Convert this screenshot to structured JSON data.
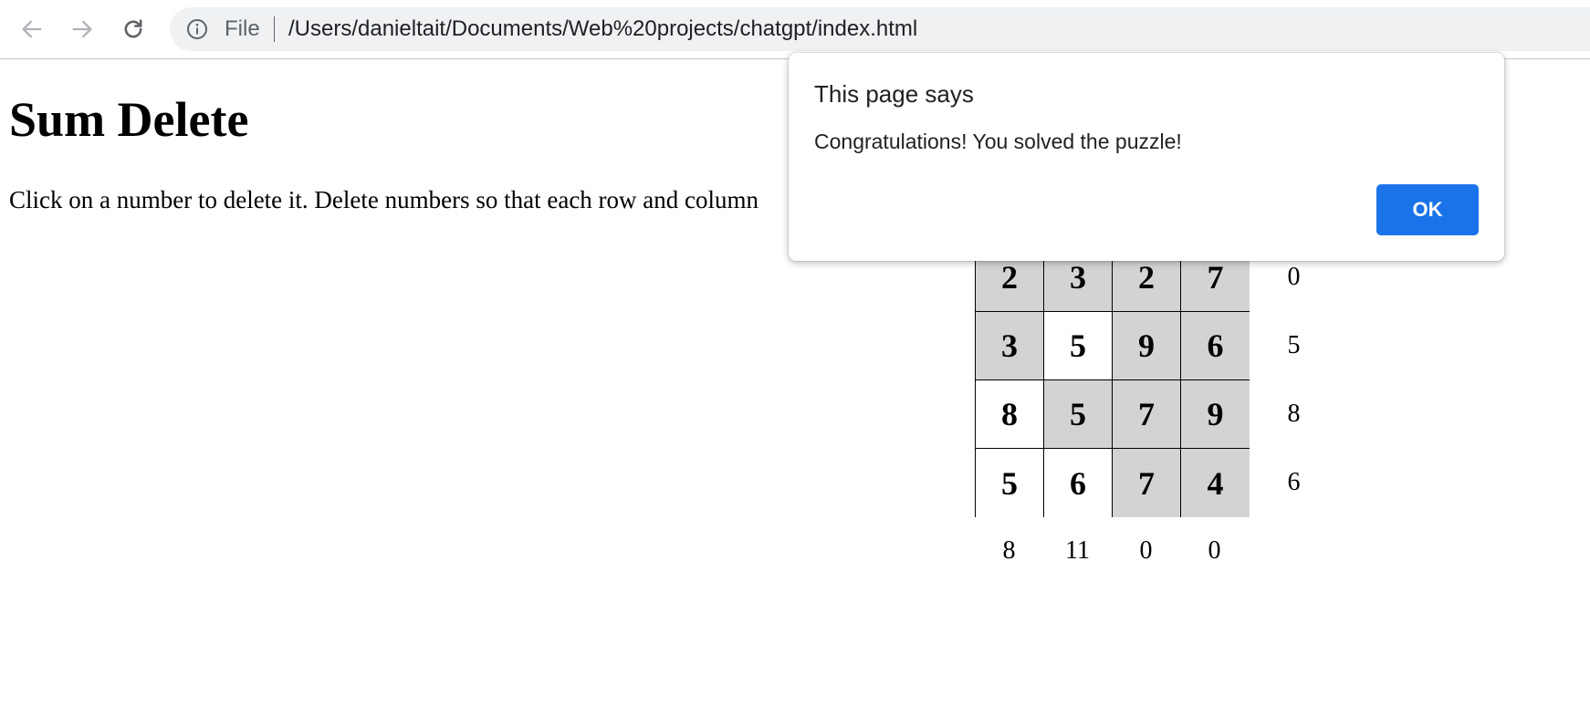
{
  "browser": {
    "back_icon": "arrow-left-icon",
    "forward_icon": "arrow-right-icon",
    "reload_icon": "reload-icon",
    "info_icon": "info-icon",
    "url_scheme_label": "File",
    "url": "/Users/danieltait/Documents/Web%20projects/chatgpt/index.html"
  },
  "page": {
    "title": "Sum Delete",
    "instructions": "Click on a number to delete it. Delete numbers so that each row and column"
  },
  "puzzle": {
    "rows": [
      [
        {
          "value": "2",
          "deleted": true
        },
        {
          "value": "3",
          "deleted": true
        },
        {
          "value": "2",
          "deleted": true
        },
        {
          "value": "7",
          "deleted": true
        }
      ],
      [
        {
          "value": "3",
          "deleted": true
        },
        {
          "value": "5",
          "deleted": false
        },
        {
          "value": "9",
          "deleted": true
        },
        {
          "value": "6",
          "deleted": true
        }
      ],
      [
        {
          "value": "8",
          "deleted": false
        },
        {
          "value": "5",
          "deleted": true
        },
        {
          "value": "7",
          "deleted": true
        },
        {
          "value": "9",
          "deleted": true
        }
      ],
      [
        {
          "value": "5",
          "deleted": false
        },
        {
          "value": "6",
          "deleted": false
        },
        {
          "value": "7",
          "deleted": true
        },
        {
          "value": "4",
          "deleted": true
        }
      ]
    ],
    "row_sums": [
      "0",
      "5",
      "8",
      "6"
    ],
    "col_sums": [
      "8",
      "11",
      "0",
      "0"
    ],
    "colors": {
      "deleted": "#d3d3d3",
      "kept": "#ffffff"
    }
  },
  "dialog": {
    "title": "This page says",
    "message": "Congratulations! You solved the puzzle!",
    "ok_label": "OK",
    "ok_color": "#1a73e8"
  }
}
